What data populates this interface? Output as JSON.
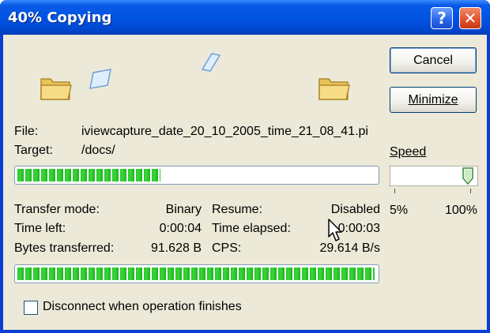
{
  "window": {
    "title": "40% Copying",
    "accent": "#0054e3"
  },
  "titlebar": {
    "help_icon": "?",
    "close_icon": "✕"
  },
  "buttons": {
    "cancel": "Cancel",
    "minimize": "Minimize"
  },
  "file": {
    "label": "File:",
    "value": "iviewcapture_date_20_10_2005_time_21_08_41.pi"
  },
  "target": {
    "label": "Target:",
    "value": "/docs/"
  },
  "speed": {
    "label": "Speed",
    "min_label": "5%",
    "max_label": "100%",
    "level": 1.0
  },
  "file_progress": {
    "fraction": 0.4
  },
  "total_progress": {
    "fraction": 1.0
  },
  "stats": {
    "transfer_mode_label": "Transfer mode:",
    "transfer_mode_value": "Binary",
    "time_left_label": "Time left:",
    "time_left_value": "0:00:04",
    "bytes_label": "Bytes transferred:",
    "bytes_value": "91.628 B",
    "resume_label": "Resume:",
    "resume_value": "Disabled",
    "elapsed_label": "Time elapsed:",
    "elapsed_value": "0:00:03",
    "cps_label": "CPS:",
    "cps_value": "29.614 B/s"
  },
  "disconnect": {
    "label": "Disconnect when operation finishes",
    "checked": false
  }
}
